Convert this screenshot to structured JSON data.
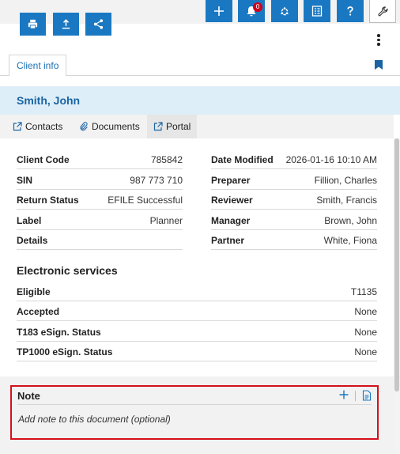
{
  "toolbar": {
    "notification_count": "0",
    "icons": [
      "add-icon",
      "bell-icon",
      "recycle-icon",
      "checklist-icon",
      "help-icon",
      "wrench-icon"
    ]
  },
  "actions": [
    "print-icon",
    "upload-icon",
    "share-icon"
  ],
  "tabs": {
    "client_info": "Client info"
  },
  "client": {
    "name": "Smith, John"
  },
  "links": {
    "contacts": "Contacts",
    "documents": "Documents",
    "portal": "Portal"
  },
  "details_left": [
    {
      "label": "Client Code",
      "value": "785842"
    },
    {
      "label": "SIN",
      "value": "987 773 710"
    },
    {
      "label": "Return Status",
      "value": "EFILE Successful"
    },
    {
      "label": "Label",
      "value": "Planner"
    },
    {
      "label": "Details",
      "value": ""
    }
  ],
  "details_right": [
    {
      "label": "Date Modified",
      "value": "2026-01-16 10:10 AM"
    },
    {
      "label": "Preparer",
      "value": "Fillion, Charles"
    },
    {
      "label": "Reviewer",
      "value": "Smith, Francis"
    },
    {
      "label": "Manager",
      "value": "Brown, John"
    },
    {
      "label": "Partner",
      "value": "White, Fiona"
    }
  ],
  "electronic_services": {
    "title": "Electronic services",
    "rows": [
      {
        "label": "Eligible",
        "value": "T1135"
      },
      {
        "label": "Accepted",
        "value": "None"
      },
      {
        "label": "T183 eSign. Status",
        "value": "None"
      },
      {
        "label": "TP1000 eSign. Status",
        "value": "None"
      }
    ]
  },
  "note": {
    "title": "Note",
    "placeholder": "Add note to this document (optional)"
  },
  "colors": {
    "accent": "#1a78c2",
    "highlight_border": "#d5101b",
    "name_bar": "#deeef8"
  }
}
